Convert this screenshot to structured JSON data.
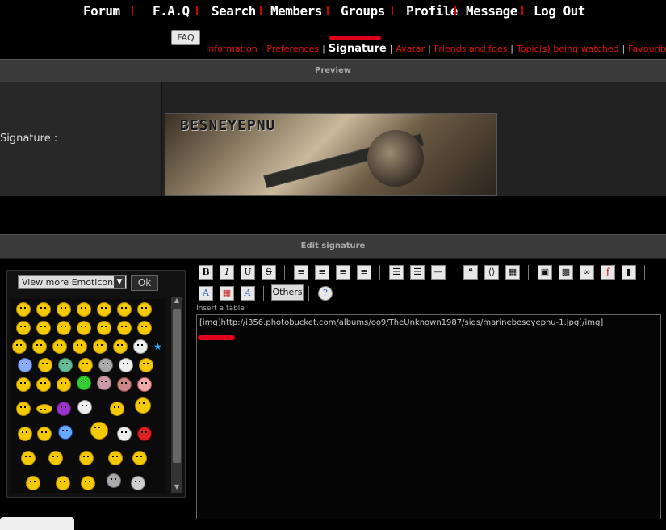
{
  "nav": {
    "items": [
      "Forum",
      "F.A.Q",
      "Search",
      "Members",
      "Groups",
      "Profile",
      "Message",
      "Log Out"
    ]
  },
  "faq_button": "FAQ",
  "profile_tabs": [
    "Information",
    "Preferences",
    "Signature",
    "Avatar",
    "Friends and foes",
    "Topic(s) being watched",
    "Favourites"
  ],
  "preview": {
    "title": "Preview",
    "signature_label": "Signature :",
    "banner_text": "BESNEYEPNU"
  },
  "edit": {
    "title": "Edit signature",
    "emoticons_select": "View more Emoticons",
    "ok_label": "Ok",
    "others_label": "Others",
    "tooltip": "Insert a table",
    "textarea_value": "[img]http://i356.photobucket.com/albums/oo9/TheUnknown1987/sigs/marinebeseyepnu-1.jpg[/img]"
  },
  "colors": {
    "accent_red": "#e0001a",
    "link_red": "#e01010",
    "bar_gray": "#3a3a3a"
  }
}
